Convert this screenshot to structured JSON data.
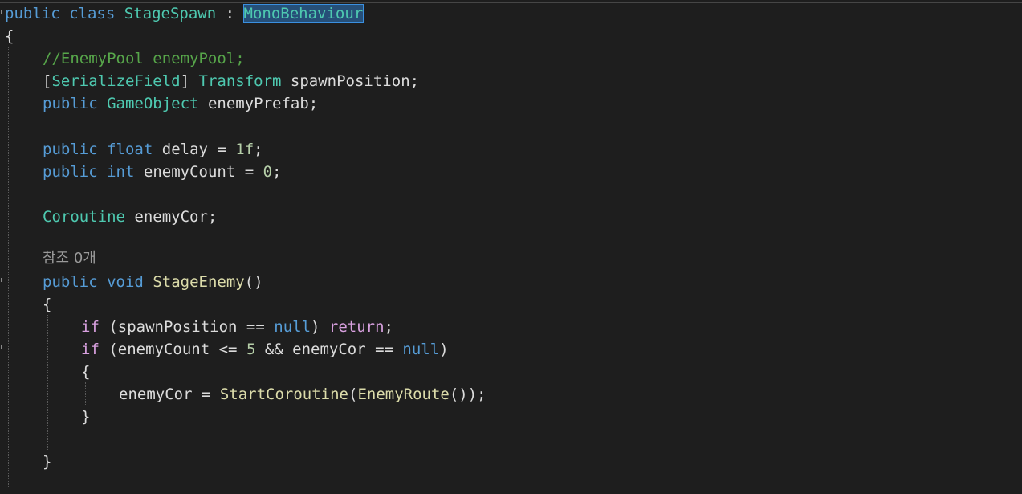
{
  "code": {
    "line1": {
      "kw1": "public",
      "kw2": "class",
      "name": "StageSpawn",
      "colon": ":",
      "base": "MonoBehaviour"
    },
    "line2": {
      "brace": "{"
    },
    "line3": {
      "comment": "//EnemyPool enemyPool;"
    },
    "line4": {
      "open": "[",
      "attr": "SerializeField",
      "close": "]",
      "type": "Transform",
      "rest": "spawnPosition;"
    },
    "line5": {
      "kw": "public",
      "type": "GameObject",
      "rest": "enemyPrefab;"
    },
    "line6": {
      "kw1": "public",
      "kw2": "float",
      "rest": "delay = ",
      "num": "1f",
      "semi": ";"
    },
    "line7": {
      "kw1": "public",
      "kw2": "int",
      "rest": "enemyCount = ",
      "num": "0",
      "semi": ";"
    },
    "line8": {
      "type": "Coroutine",
      "rest": "enemyCor;"
    },
    "codelens": "참조 0개",
    "line9": {
      "kw1": "public",
      "kw2": "void",
      "fn": "StageEnemy",
      "rest": "()"
    },
    "line10": {
      "brace": "{"
    },
    "line11": {
      "ctl": "if",
      "p1": "(spawnPosition == ",
      "kw": "null",
      "p2": ") ",
      "ret": "return",
      "semi": ";"
    },
    "line12": {
      "ctl": "if",
      "p1": "(enemyCount <= ",
      "num": "5",
      "p2": " && enemyCor == ",
      "kw": "null",
      "p3": ")"
    },
    "line13": {
      "brace": "{"
    },
    "line14": {
      "p1": "enemyCor = ",
      "fn1": "StartCoroutine",
      "p2": "(",
      "fn2": "EnemyRoute",
      "p3": "());"
    },
    "line15": {
      "brace": "}"
    },
    "line16": {
      "brace": "}"
    }
  },
  "colors": {
    "background": "#1e1e1e",
    "keyword": "#569cd6",
    "type": "#4ec9b0",
    "comment": "#57a64a",
    "number": "#b5cea8",
    "method": "#dcdcaa",
    "control": "#d8a0df",
    "plain": "#dcdcdc"
  }
}
